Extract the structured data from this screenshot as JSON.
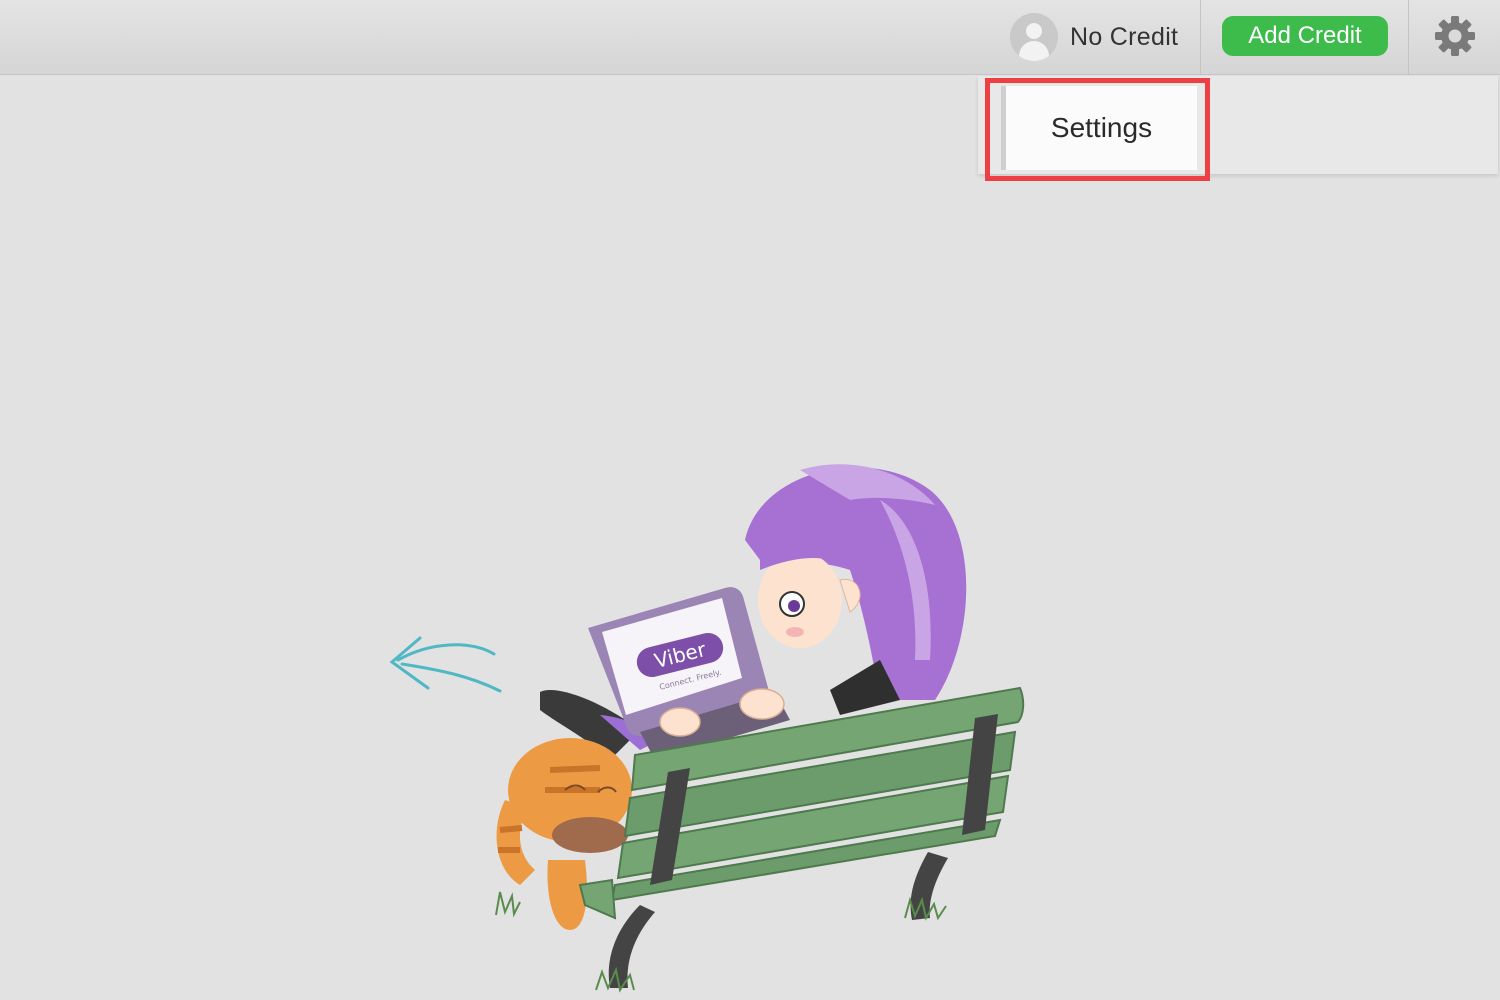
{
  "header": {
    "account_label": "No Credit",
    "add_credit_label": "Add Credit",
    "accent_green": "#3dbb4b",
    "avatar_icon": "user-avatar-icon",
    "settings_icon": "gear-icon"
  },
  "dropdown": {
    "items": [
      {
        "label": "Settings"
      }
    ],
    "highlight_color": "#ee3f45"
  },
  "illustration": {
    "laptop_logo": "Viber",
    "laptop_tagline": "Connect. Freely."
  }
}
